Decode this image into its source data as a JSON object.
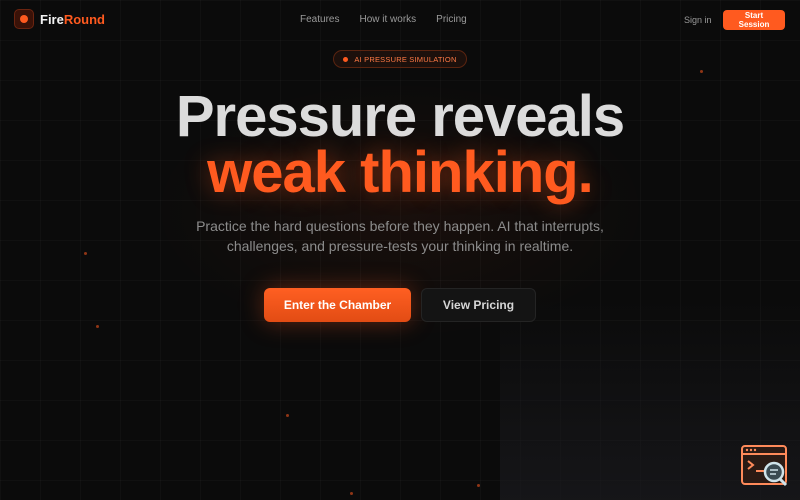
{
  "nav": {
    "brand": {
      "name_part1": "Fire",
      "name_part2": "Round"
    },
    "links": [
      "Features",
      "How it works",
      "Pricing"
    ],
    "signin_label": "Sign in",
    "cta_label": "Start Session"
  },
  "hero": {
    "badge": "AI PRESSURE SIMULATION",
    "headline_line1": "Pressure reveals",
    "headline_line2": "weak thinking.",
    "subtitle_line1": "Practice the hard questions before they happen. AI that interrupts,",
    "subtitle_line2": "challenges, and pressure-tests your thinking in realtime.",
    "primary_cta": "Enter the Chamber",
    "secondary_cta": "View Pricing"
  },
  "colors": {
    "accent": "#ff5a1f",
    "background": "#0b0b0b",
    "headline": "#dcdcdc",
    "muted_text": "#8c8c8c"
  },
  "icons": {
    "brand": "fire-circle-icon",
    "widget": "terminal-search-icon"
  }
}
